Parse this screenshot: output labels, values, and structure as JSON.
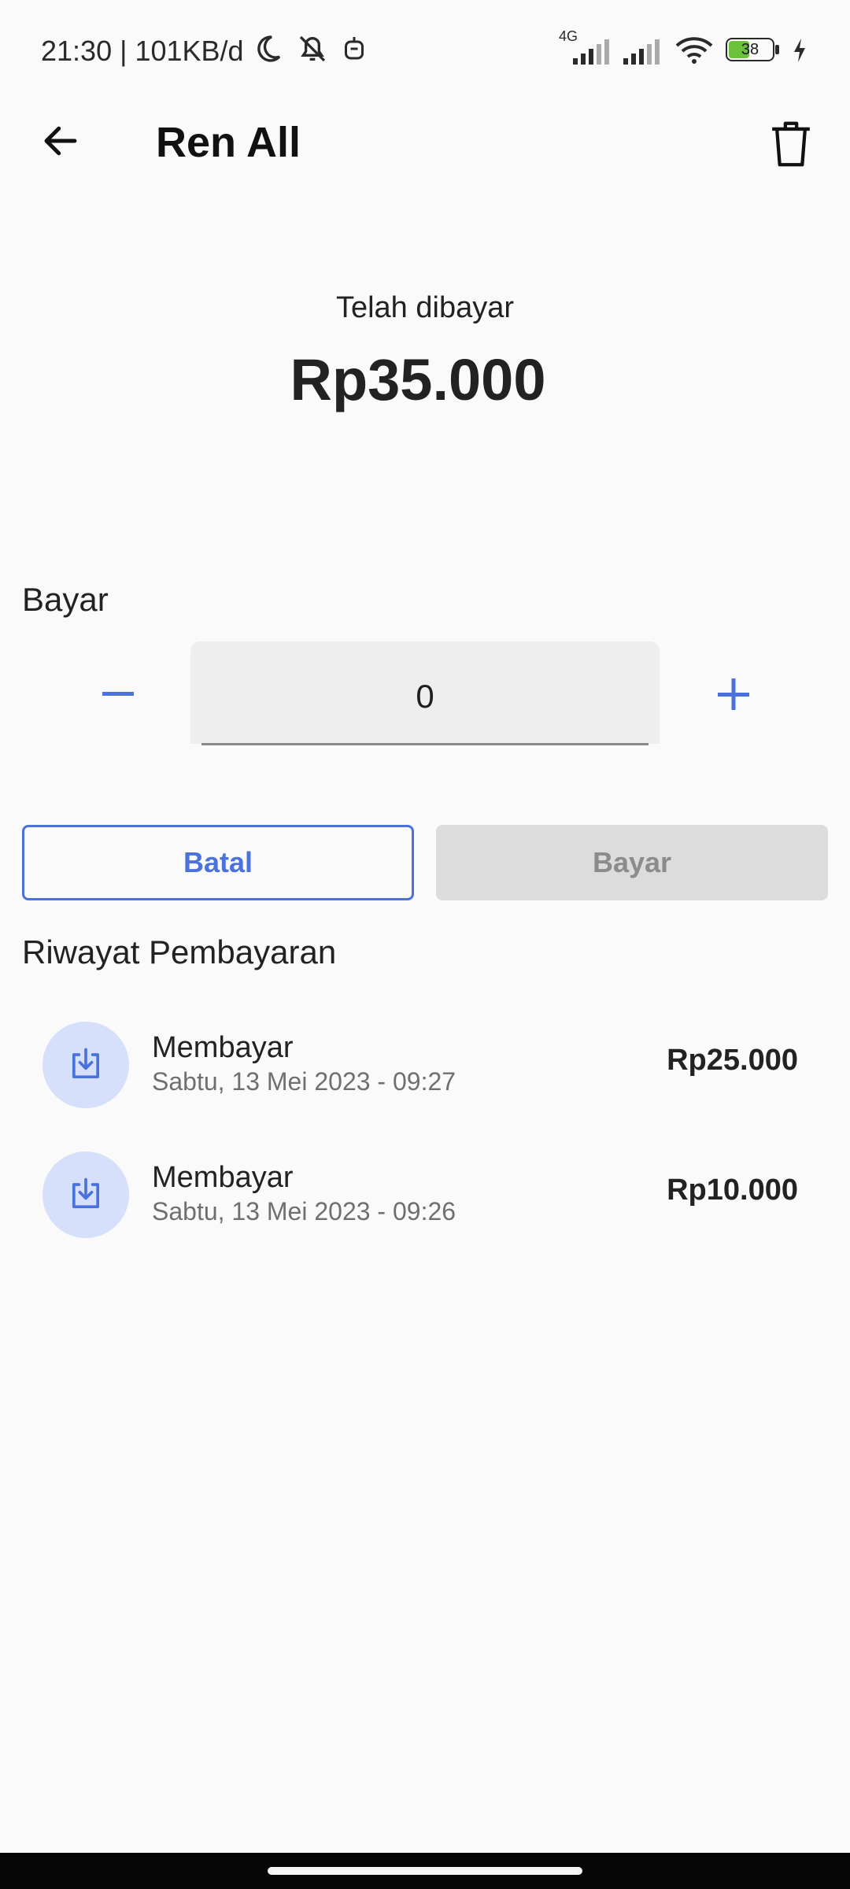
{
  "status_bar": {
    "left_text": "21:30 | 101KB/d",
    "network_label": "4G",
    "battery": "38"
  },
  "app_bar": {
    "title": "Ren All"
  },
  "summary": {
    "label": "Telah dibayar",
    "amount": "Rp35.000"
  },
  "pay": {
    "label": "Bayar",
    "value": "0",
    "cancel_label": "Batal",
    "submit_label": "Bayar"
  },
  "history": {
    "title": "Riwayat Pembayaran",
    "items": [
      {
        "title": "Membayar",
        "date": "Sabtu, 13 Mei 2023 - 09:27",
        "amount": "Rp25.000"
      },
      {
        "title": "Membayar",
        "date": "Sabtu, 13 Mei 2023 - 09:26",
        "amount": "Rp10.000"
      }
    ]
  },
  "colors": {
    "accent": "#4b72dc",
    "icon_bg": "#d6e0fb",
    "disabled_bg": "#dcdcdc",
    "background": "#fafafa"
  },
  "icons": [
    "arrow-left",
    "trash",
    "minus",
    "plus",
    "download-tray"
  ]
}
